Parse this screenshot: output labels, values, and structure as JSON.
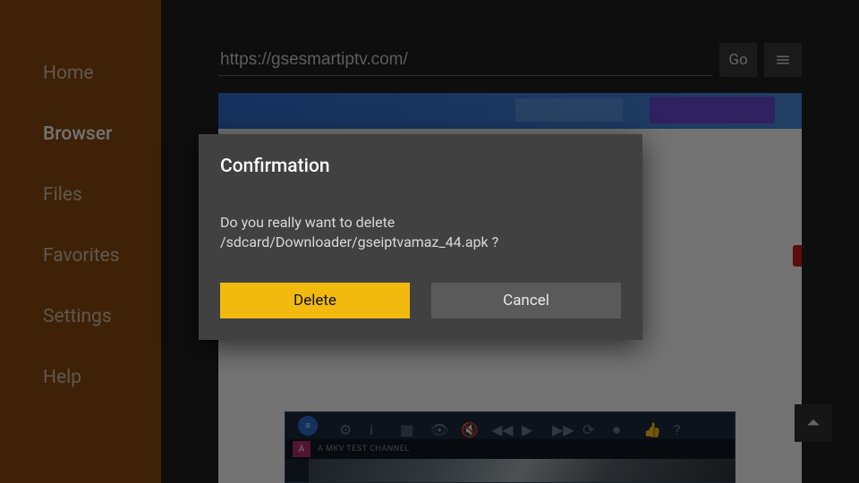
{
  "sidebar": {
    "items": [
      {
        "label": "Home"
      },
      {
        "label": "Browser"
      },
      {
        "label": "Files"
      },
      {
        "label": "Favorites"
      },
      {
        "label": "Settings"
      },
      {
        "label": "Help"
      }
    ],
    "activeIndex": 1
  },
  "urlbar": {
    "value": "https://gsesmartiptv.com/",
    "go_label": "Go"
  },
  "webview": {
    "channel_badge": "A",
    "channel_text": "A MKV TEST CHANNEL"
  },
  "dialog": {
    "title": "Confirmation",
    "message": "Do you really want to delete /sdcard/Downloader/gseiptvamaz_44.apk ?",
    "delete_label": "Delete",
    "cancel_label": "Cancel"
  }
}
